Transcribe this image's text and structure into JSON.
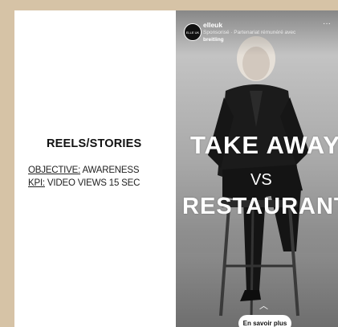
{
  "left_panel": {
    "title": "REELS/STORIES",
    "objective_label": "OBJECTIVE:",
    "objective_value": " AWARENESS",
    "kpi_label": "KPI:",
    "kpi_value": " VIDEO VIEWS 15 SEC"
  },
  "story": {
    "avatar_text": "ELLE UK",
    "account": "elleuk",
    "sponsored": "Sponsorisé · Partenariat rémunéré avec",
    "partner": "breitling",
    "more": "···",
    "headline_top": "TAKE AWAY",
    "headline_vs": "VS",
    "headline_bottom": "RESTAURANT",
    "swipe_icon": "chevron-up-icon",
    "cta_label": "En savoir plus"
  },
  "colors": {
    "background": "#d6c3a6",
    "card": "#ffffff",
    "cta_bg": "#ffffff"
  }
}
